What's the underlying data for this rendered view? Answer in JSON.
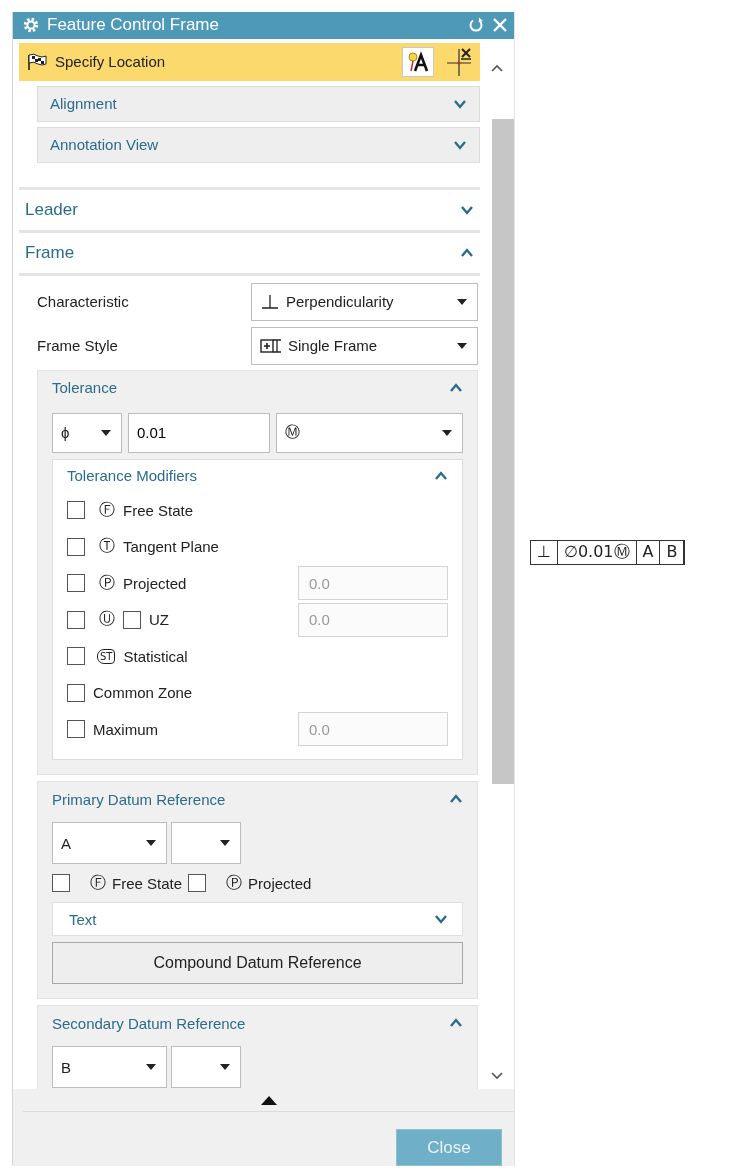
{
  "window": {
    "title": "Feature Control Frame"
  },
  "location": {
    "label": "Specify Location",
    "selected": true
  },
  "origin_groups": [
    {
      "title": "Alignment",
      "expanded": false
    },
    {
      "title": "Annotation View",
      "expanded": false
    }
  ],
  "leader": {
    "title": "Leader",
    "expanded": false
  },
  "frame": {
    "title": "Frame",
    "expanded": true,
    "fields": [
      {
        "label": "Characteristic",
        "value": "Perpendicularity",
        "kind": "perpendicular"
      },
      {
        "label": "Frame Style",
        "value": "Single Frame",
        "kind": "single-frame"
      }
    ],
    "tolerance": {
      "title": "Tolerance",
      "expanded": true,
      "zone_shape": "ϕ",
      "value": "0.01",
      "material_modifier": "Ⓜ",
      "modifiers": {
        "title": "Tolerance Modifiers",
        "expanded": true,
        "items": [
          {
            "kind": "circled",
            "symbol": "Ⓕ",
            "label": "Free State",
            "checked": false
          },
          {
            "kind": "circled",
            "symbol": "Ⓣ",
            "label": "Tangent Plane",
            "checked": false
          },
          {
            "kind": "circled",
            "symbol": "Ⓟ",
            "label": "Projected",
            "checked": false,
            "value": "0.0",
            "disabled": true
          },
          {
            "kind": "circled",
            "symbol": "Ⓤ",
            "label": "UZ",
            "checked": false,
            "inner_checked": false,
            "value": "0.0",
            "disabled": true
          },
          {
            "kind": "hexagon",
            "symbol": "ST",
            "label": "Statistical",
            "checked": false
          },
          {
            "kind": "plain",
            "label": "Common Zone",
            "checked": false
          },
          {
            "kind": "plain",
            "label": "Maximum",
            "checked": false,
            "value": "0.0",
            "disabled": true
          }
        ]
      }
    },
    "datums": [
      {
        "title": "Primary Datum Reference",
        "expanded": true,
        "letter": "A",
        "options": [
          {
            "symbol": "Ⓕ",
            "label": "Free State",
            "checked": false
          },
          {
            "symbol": "Ⓟ",
            "label": "Projected",
            "checked": false
          }
        ],
        "text_group": {
          "title": "Text",
          "expanded": false
        },
        "button": "Compound Datum Reference"
      },
      {
        "title": "Secondary Datum Reference",
        "expanded": true,
        "letter": "B"
      }
    ]
  },
  "footer": {
    "button": "Close"
  },
  "preview": {
    "cells": [
      "⊥",
      "∅0.01Ⓜ",
      "A",
      "B"
    ]
  }
}
